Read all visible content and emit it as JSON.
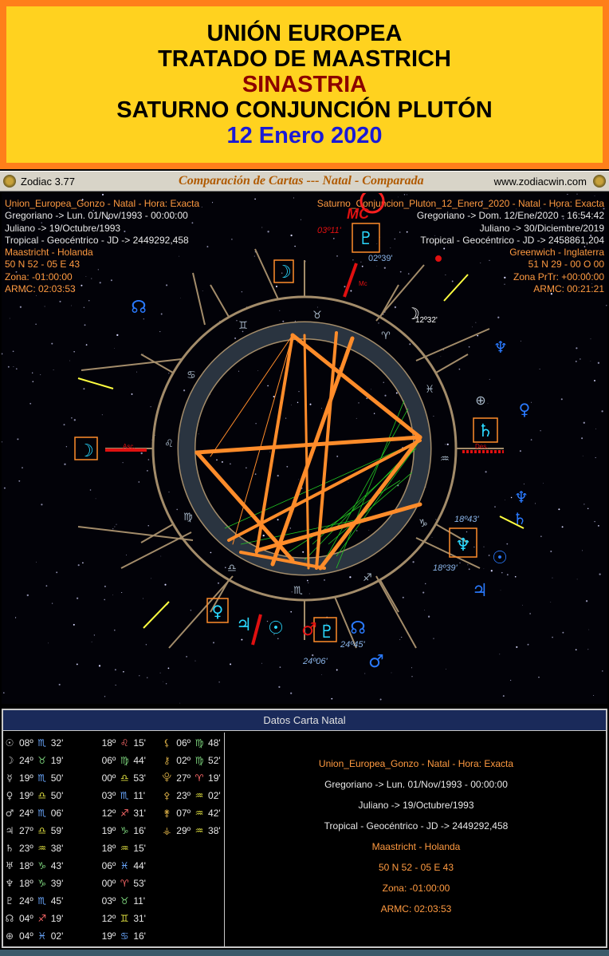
{
  "banner": {
    "line1": "UNIÓN EUROPEA",
    "line2": "TRATADO DE MAASTRICH",
    "line3": "SINASTRIA",
    "line4": "SATURNO CONJUNCIÓN PLUTÓN",
    "line5": "12 Enero 2020"
  },
  "app": {
    "name": "Zodiac 3.77",
    "window_title": "Comparación de Cartas --- Natal - Comparada",
    "url": "www.zodiacwin.com"
  },
  "natal": {
    "name": "Union_Europea_Gonzo - Natal - Hora: Exacta",
    "gregorian": "Gregoriano -> Lun. 01/Nov/1993 - 00:00:00",
    "julian": "Juliano -> 19/Octubre/1993",
    "system": "Tropical - Geocéntrico - JD -> 2449292,458",
    "place": "Maastricht - Holanda",
    "coords": "50 N 52 - 05 E 43",
    "zone": "Zona: -01:00:00",
    "armc": "ARMC: 02:03:53"
  },
  "compared": {
    "name": "Saturno_Conjuncion_Pluton_12_Enero_2020 - Natal - Hora: Exacta",
    "gregorian": "Gregoriano -> Dom. 12/Ene/2020 - 16:54:42",
    "julian": "Juliano -> 30/Diciembre/2019",
    "system": "Tropical - Geocéntrico - JD -> 2458861,204",
    "place": "Greenwich - Inglaterra",
    "coords": "51 N 29 - 00 O 00",
    "zone": "Zona PrTr: +00:00:00",
    "armc": "ARMC: 00:21:21"
  },
  "wheel_labels": {
    "mc_label": "MC",
    "mc_degree": "03º11'",
    "pluto_top": "02º39'",
    "moon_deg": "12º32'",
    "mc_small": "Mc",
    "asc_small": "Asc.",
    "des_small": "Des.",
    "nep_deg1": "18º43'",
    "nep_deg2": "18º39'",
    "pluto_deg1": "24º45'",
    "pluto_deg2": "24º06'"
  },
  "bottom_panel": {
    "header": "Datos Carta Natal"
  },
  "positions": [
    [
      "☉",
      "08º",
      "♏",
      "32'",
      "18º",
      "♌",
      "15'",
      "⚸",
      "06º",
      "♍",
      "48'"
    ],
    [
      "☽",
      "24º",
      "♉",
      "19'",
      "06º",
      "♍",
      "44'",
      "⚷",
      "02º",
      "♍",
      "52'"
    ],
    [
      "☿",
      "19º",
      "♏",
      "50'",
      "00º",
      "♎",
      "53'",
      "⯓",
      "27º",
      "♈",
      "19'"
    ],
    [
      "♀",
      "19º",
      "♎",
      "50'",
      "03º",
      "♏",
      "11'",
      "⚴",
      "23º",
      "♒",
      "02'"
    ],
    [
      "♂",
      "24º",
      "♏",
      "06'",
      "12º",
      "♐",
      "31'",
      "⚵",
      "07º",
      "♒",
      "42'"
    ],
    [
      "♃",
      "27º",
      "♎",
      "59'",
      "19º",
      "♑",
      "16'",
      "⚶",
      "29º",
      "♒",
      "38'"
    ],
    [
      "♄",
      "23º",
      "♒",
      "38'",
      "18º",
      "♒",
      "15'",
      "",
      "",
      "",
      ""
    ],
    [
      "♅",
      "18º",
      "♑",
      "43'",
      "06º",
      "♓",
      "44'",
      "",
      "",
      "",
      ""
    ],
    [
      "♆",
      "18º",
      "♑",
      "39'",
      "00º",
      "♈",
      "53'",
      "",
      "",
      "",
      ""
    ],
    [
      "♇",
      "24º",
      "♏",
      "45'",
      "03º",
      "♉",
      "11'",
      "",
      "",
      "",
      ""
    ],
    [
      "☊",
      "04º",
      "♐",
      "19'",
      "12º",
      "♊",
      "31'",
      "",
      "",
      "",
      ""
    ],
    [
      "⊕",
      "04º",
      "♓",
      "02'",
      "19º",
      "♋",
      "16'",
      "",
      "",
      "",
      ""
    ]
  ],
  "colors": {
    "orange_frame": "#ff7f1a",
    "yellow_fill": "#ffd21f",
    "title_red": "#8b0000",
    "title_blue": "#1a1ad6",
    "wheel_ring": "#a38c6a",
    "aspect_orange": "#ff8c2a",
    "aspect_green": "#22c422",
    "axis_red": "#e01010",
    "glyph_cyan": "#2ad8ff",
    "glyph_blue": "#2a7aff"
  }
}
